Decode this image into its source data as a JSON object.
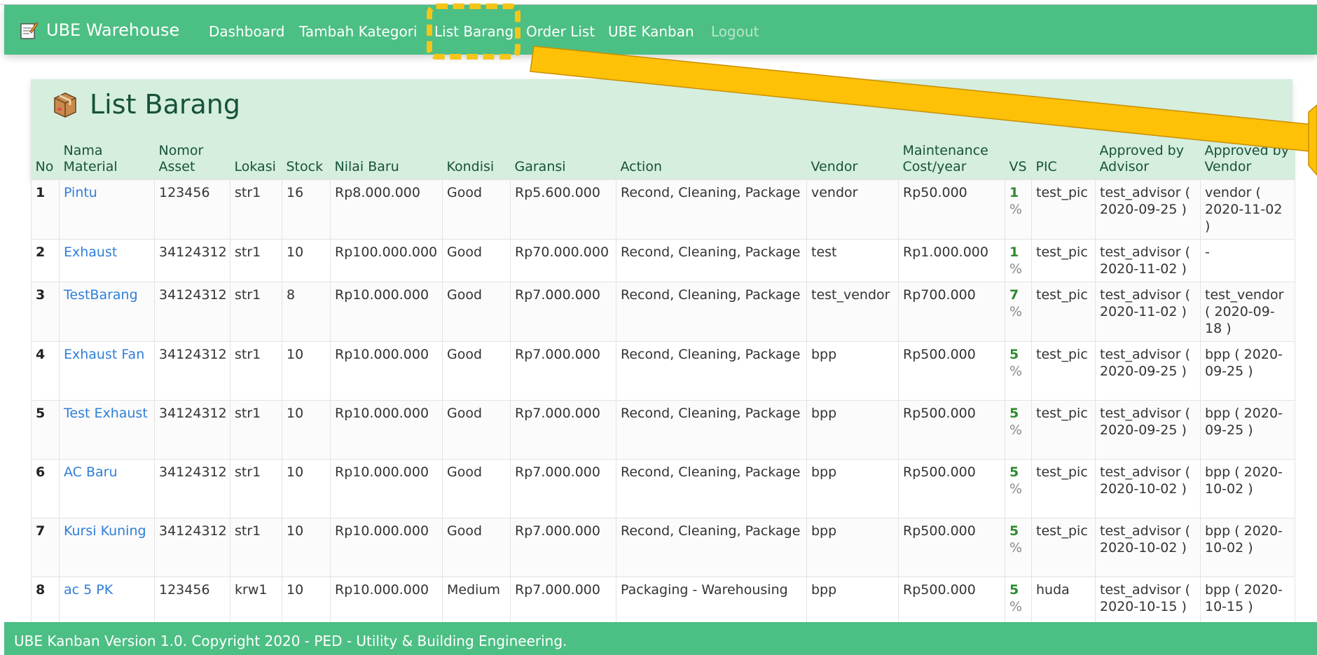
{
  "navbar": {
    "brand": "UBE Warehouse",
    "items": [
      {
        "label": "Dashboard"
      },
      {
        "label": "Tambah Kategori"
      },
      {
        "label": "List Barang"
      },
      {
        "label": "Order List"
      },
      {
        "label": "UBE Kanban"
      },
      {
        "label": "Logout"
      }
    ],
    "color": "#4cbf84"
  },
  "page": {
    "title": "List Barang"
  },
  "table": {
    "headers": {
      "no": "No",
      "nama": "Nama Material",
      "nomor": "Nomor Asset",
      "lokasi": "Lokasi",
      "stock": "Stock",
      "nilai": "Nilai Baru",
      "kondisi": "Kondisi",
      "garansi": "Garansi",
      "action": "Action",
      "vendor": "Vendor",
      "maint": "Maintenance Cost/year",
      "vs": "VS",
      "pic": "PIC",
      "adv": "Approved by Advisor",
      "ven": "Approved by Vendor"
    },
    "rows": [
      {
        "no": "1",
        "nama": "Pintu",
        "nomor": "123456",
        "lokasi": "str1",
        "stock": "16",
        "nilai": "Rp8.000.000",
        "kondisi": "Good",
        "garansi": "Rp5.600.000",
        "action": "Recond, Cleaning, Package",
        "vendor": "vendor",
        "maint": "Rp50.000",
        "vs": "1",
        "vs_unit": "%",
        "pic": "test_pic",
        "adv": "test_advisor ( 2020-09-25 )",
        "ven": "vendor ( 2020-11-02 )"
      },
      {
        "no": "2",
        "nama": "Exhaust",
        "nomor": "34124312",
        "lokasi": "str1",
        "stock": "10",
        "nilai": "Rp100.000.000",
        "kondisi": "Good",
        "garansi": "Rp70.000.000",
        "action": "Recond, Cleaning, Package",
        "vendor": "test",
        "maint": "Rp1.000.000",
        "vs": "1",
        "vs_unit": "%",
        "pic": "test_pic",
        "adv": "test_advisor ( 2020-11-02 )",
        "ven": "-"
      },
      {
        "no": "3",
        "nama": "TestBarang",
        "nomor": "34124312",
        "lokasi": "str1",
        "stock": "8",
        "nilai": "Rp10.000.000",
        "kondisi": "Good",
        "garansi": "Rp7.000.000",
        "action": "Recond, Cleaning, Package",
        "vendor": "test_vendor",
        "maint": "Rp700.000",
        "vs": "7",
        "vs_unit": "%",
        "pic": "test_pic",
        "adv": "test_advisor ( 2020-11-02 )",
        "ven": "test_vendor ( 2020-09-18 )"
      },
      {
        "no": "4",
        "nama": "Exhaust Fan",
        "nomor": "34124312",
        "lokasi": "str1",
        "stock": "10",
        "nilai": "Rp10.000.000",
        "kondisi": "Good",
        "garansi": "Rp7.000.000",
        "action": "Recond, Cleaning, Package",
        "vendor": "bpp",
        "maint": "Rp500.000",
        "vs": "5",
        "vs_unit": "%",
        "pic": "test_pic",
        "adv": "test_advisor ( 2020-09-25 )",
        "ven": "bpp ( 2020-09-25 )"
      },
      {
        "no": "5",
        "nama": "Test Exhaust",
        "nomor": "34124312",
        "lokasi": "str1",
        "stock": "10",
        "nilai": "Rp10.000.000",
        "kondisi": "Good",
        "garansi": "Rp7.000.000",
        "action": "Recond, Cleaning, Package",
        "vendor": "bpp",
        "maint": "Rp500.000",
        "vs": "5",
        "vs_unit": "%",
        "pic": "test_pic",
        "adv": "test_advisor ( 2020-09-25 )",
        "ven": "bpp ( 2020-09-25 )"
      },
      {
        "no": "6",
        "nama": "AC Baru",
        "nomor": "34124312",
        "lokasi": "str1",
        "stock": "10",
        "nilai": "Rp10.000.000",
        "kondisi": "Good",
        "garansi": "Rp7.000.000",
        "action": "Recond, Cleaning, Package",
        "vendor": "bpp",
        "maint": "Rp500.000",
        "vs": "5",
        "vs_unit": "%",
        "pic": "test_pic",
        "adv": "test_advisor ( 2020-10-02 )",
        "ven": "bpp ( 2020-10-02 )"
      },
      {
        "no": "7",
        "nama": "Kursi Kuning",
        "nomor": "34124312",
        "lokasi": "str1",
        "stock": "10",
        "nilai": "Rp10.000.000",
        "kondisi": "Good",
        "garansi": "Rp7.000.000",
        "action": "Recond, Cleaning, Package",
        "vendor": "bpp",
        "maint": "Rp500.000",
        "vs": "5",
        "vs_unit": "%",
        "pic": "test_pic",
        "adv": "test_advisor ( 2020-10-02 )",
        "ven": "bpp ( 2020-10-02 )"
      },
      {
        "no": "8",
        "nama": "ac 5 PK",
        "nomor": "123456",
        "lokasi": "krw1",
        "stock": "10",
        "nilai": "Rp10.000.000",
        "kondisi": "Medium",
        "garansi": "Rp7.000.000",
        "action": "Packaging - Warehousing",
        "vendor": "bpp",
        "maint": "Rp500.000",
        "vs": "5",
        "vs_unit": "%",
        "pic": "huda",
        "adv": "test_advisor ( 2020-10-15 )",
        "ven": "bpp ( 2020-10-15 )"
      }
    ]
  },
  "footer": {
    "text": "UBE Kanban Version 1.0. Copyright 2020 - PED - Utility & Building Engineering."
  },
  "annotation": {
    "highlight_color": "#f5c518",
    "arrow_color": "#ffc107"
  }
}
